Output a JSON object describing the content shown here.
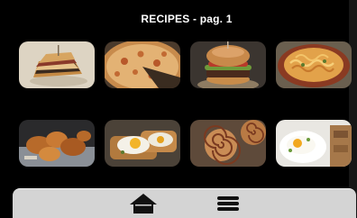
{
  "header": {
    "title": "RECIPES - pag. 1"
  },
  "recipes": [
    {
      "name": "club-sandwich",
      "icon": "club-sandwich-photo"
    },
    {
      "name": "pizza",
      "icon": "pizza-photo"
    },
    {
      "name": "burger",
      "icon": "burger-photo"
    },
    {
      "name": "pasta-bake",
      "icon": "pasta-bake-photo"
    },
    {
      "name": "fried-chicken",
      "icon": "fried-chicken-photo"
    },
    {
      "name": "egg-toast",
      "icon": "egg-toast-photo"
    },
    {
      "name": "pinwheel-pastries",
      "icon": "pinwheel-pastries-photo"
    },
    {
      "name": "eggs-breakfast",
      "icon": "eggs-breakfast-photo"
    }
  ],
  "bottom_bar": {
    "home_icon": "home-icon",
    "menu_icon": "menu-icon"
  },
  "colors": {
    "background": "#000000",
    "title_text": "#ffffff",
    "bottom_bar": "#d4d4d4",
    "icon": "#111111"
  }
}
